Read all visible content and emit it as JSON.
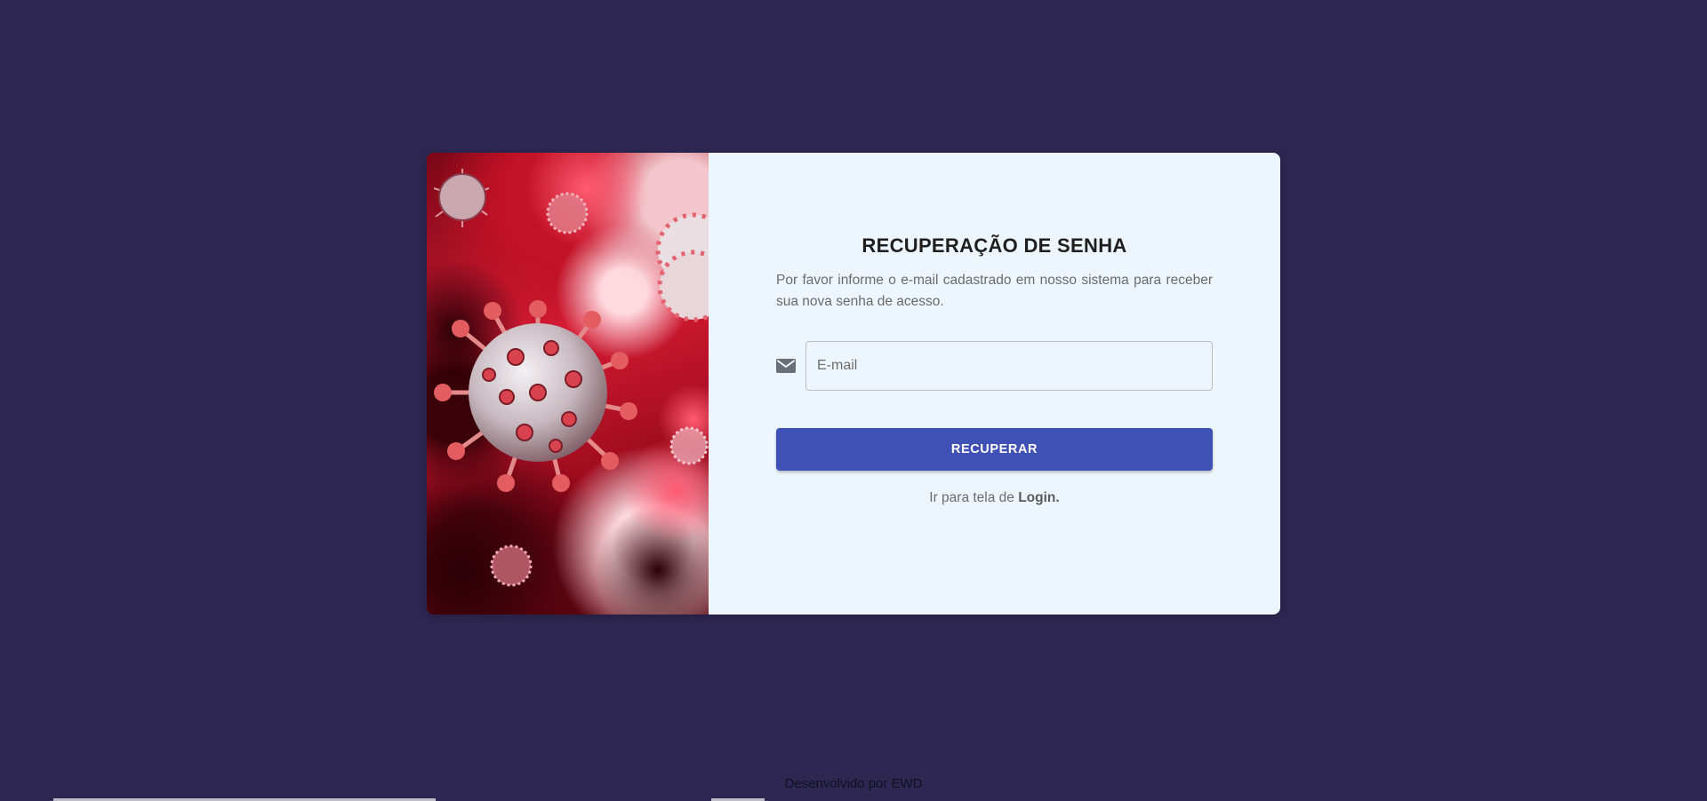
{
  "recovery": {
    "title": "RECUPERAÇÃO DE SENHA",
    "description": "Por favor informe o e-mail cadastrado em nosso sistema para receber sua nova senha de acesso.",
    "email_placeholder": "E-mail",
    "email_value": "",
    "submit_label": "RECUPERAR",
    "login_prefix": "Ir para tela de ",
    "login_link": "Login."
  },
  "footer": {
    "text": "Desenvolvido por EWD"
  },
  "image": {
    "subject": "coronavirus particles illustration"
  },
  "icons": {
    "email": "mail-icon"
  },
  "colors": {
    "page_background": "#2e2752",
    "form_background": "#eef6fd",
    "button": "#3f51b5",
    "virus_accent": "#d61b34"
  }
}
